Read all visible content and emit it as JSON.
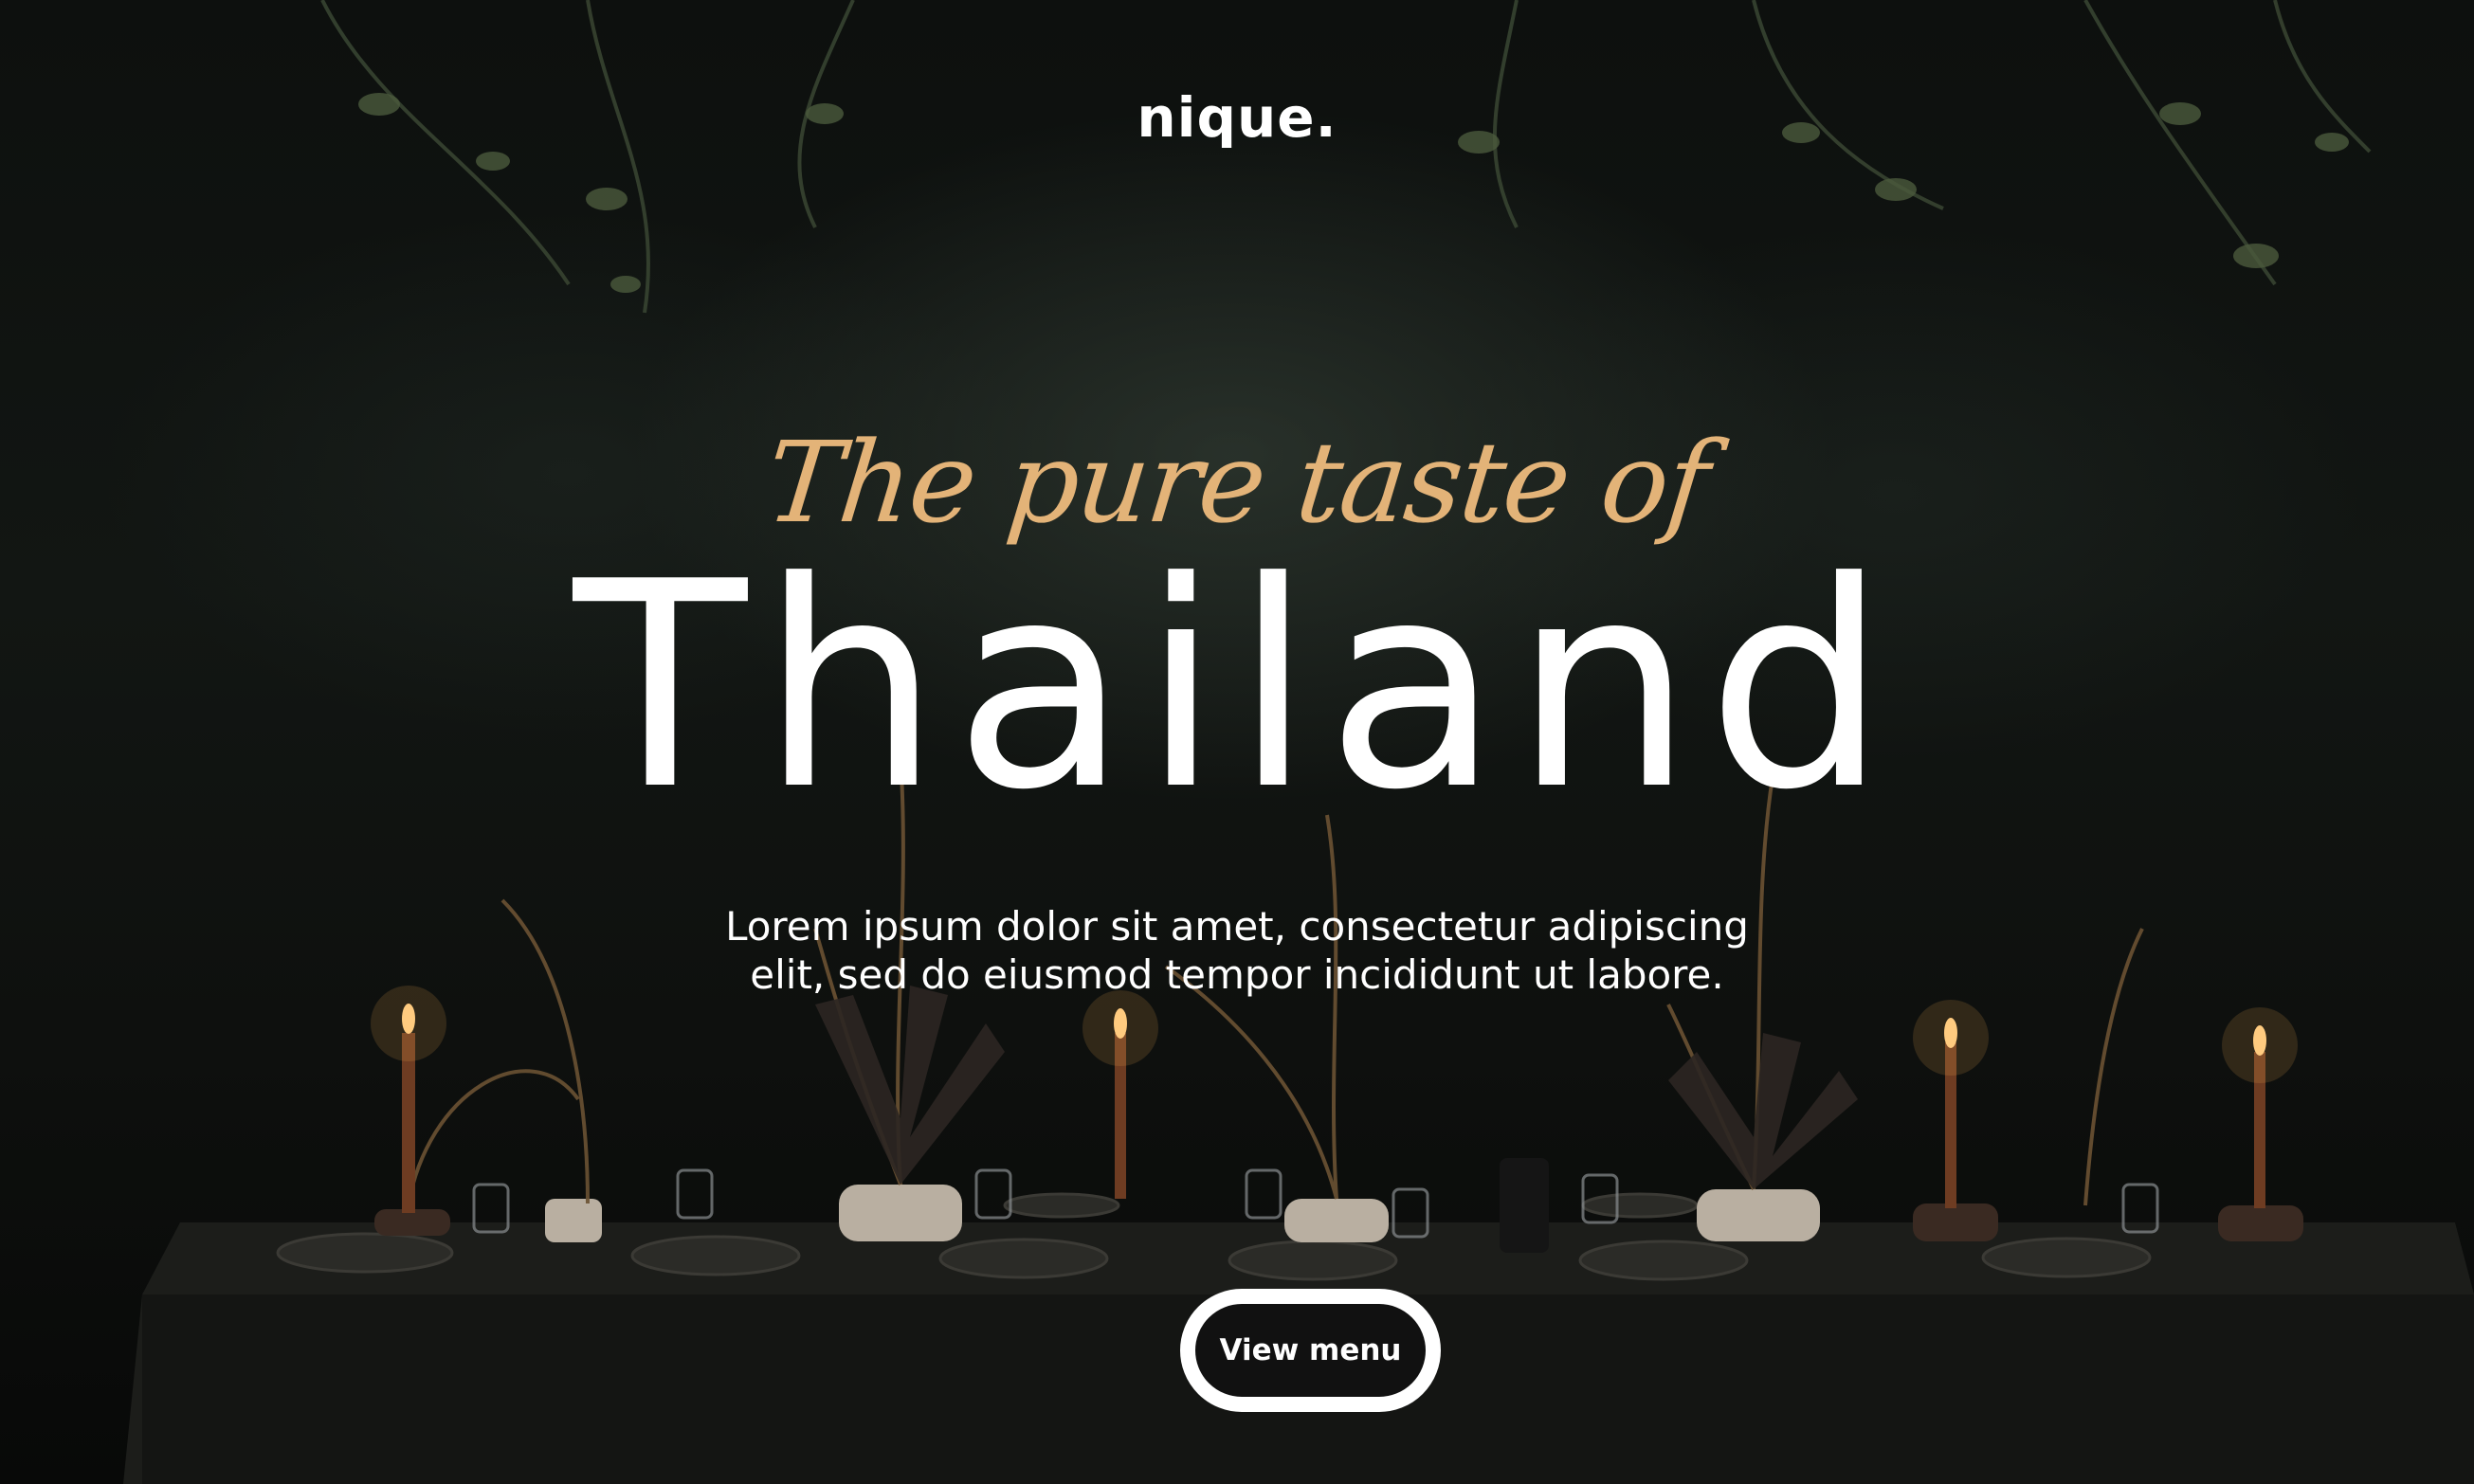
{
  "brand": {
    "logo": "nique."
  },
  "hero": {
    "tagline": "The pure taste of",
    "headline": "Thailand",
    "lead_line_1": "Lorem ipsum dolor sit amet, consectetur adipiscing",
    "lead_line_2": "elit, sed do eiusmod tempor incididunt ut labore.",
    "cta_label": "View menu",
    "background": "dark dining table with candles and dried plants",
    "colors": {
      "accent": "#e3b378",
      "text": "#ffffff",
      "button_fill": "#111111",
      "background": "#0b0c0b"
    }
  }
}
